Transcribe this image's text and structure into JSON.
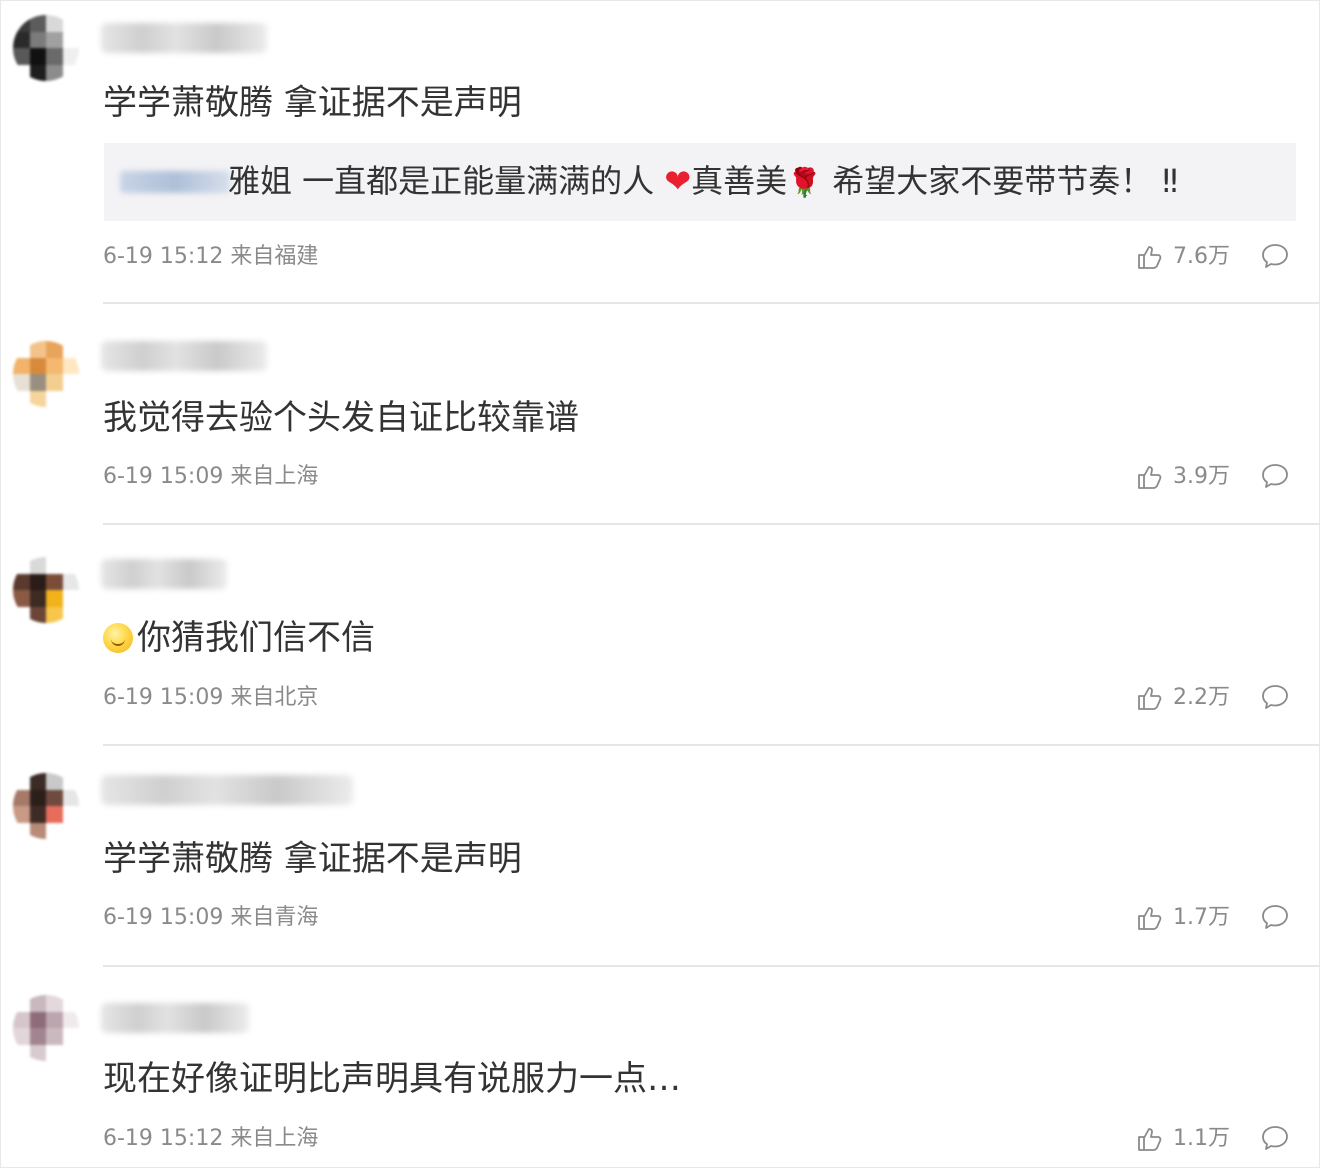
{
  "comments": [
    {
      "text": "学学萧敬腾 拿证据不是声明",
      "quote": {
        "text_before": "雅姐 一直都是正能量满满的人 ",
        "heart": "❤",
        "text_mid": "真善美",
        "rose": "🌹",
        "text_after": " 希望大家不要带节奏！ ‼"
      },
      "meta": "6-19 15:12 来自福建",
      "likes": "7.6万"
    },
    {
      "text": "我觉得去验个头发自证比较靠谱",
      "meta": "6-19 15:09 来自上海",
      "likes": "3.9万"
    },
    {
      "text": "你猜我们信不信",
      "emoji": "smile-emoji",
      "meta": "6-19 15:09 来自北京",
      "likes": "2.2万"
    },
    {
      "text": "学学萧敬腾 拿证据不是声明",
      "meta": "6-19 15:09 来自青海",
      "likes": "1.7万"
    },
    {
      "text": "现在好像证明比声明具有说服力一点…",
      "meta": "6-19 15:12 来自上海",
      "likes": "1.1万"
    }
  ],
  "icons": {
    "like": "thumbs-up-icon",
    "reply": "comment-bubble-icon"
  },
  "colors": {
    "text": "#333333",
    "meta": "#8a8a8a",
    "divider": "#e6e6e6",
    "quote_bg": "#f3f3f5",
    "heart": "#e8202f"
  }
}
